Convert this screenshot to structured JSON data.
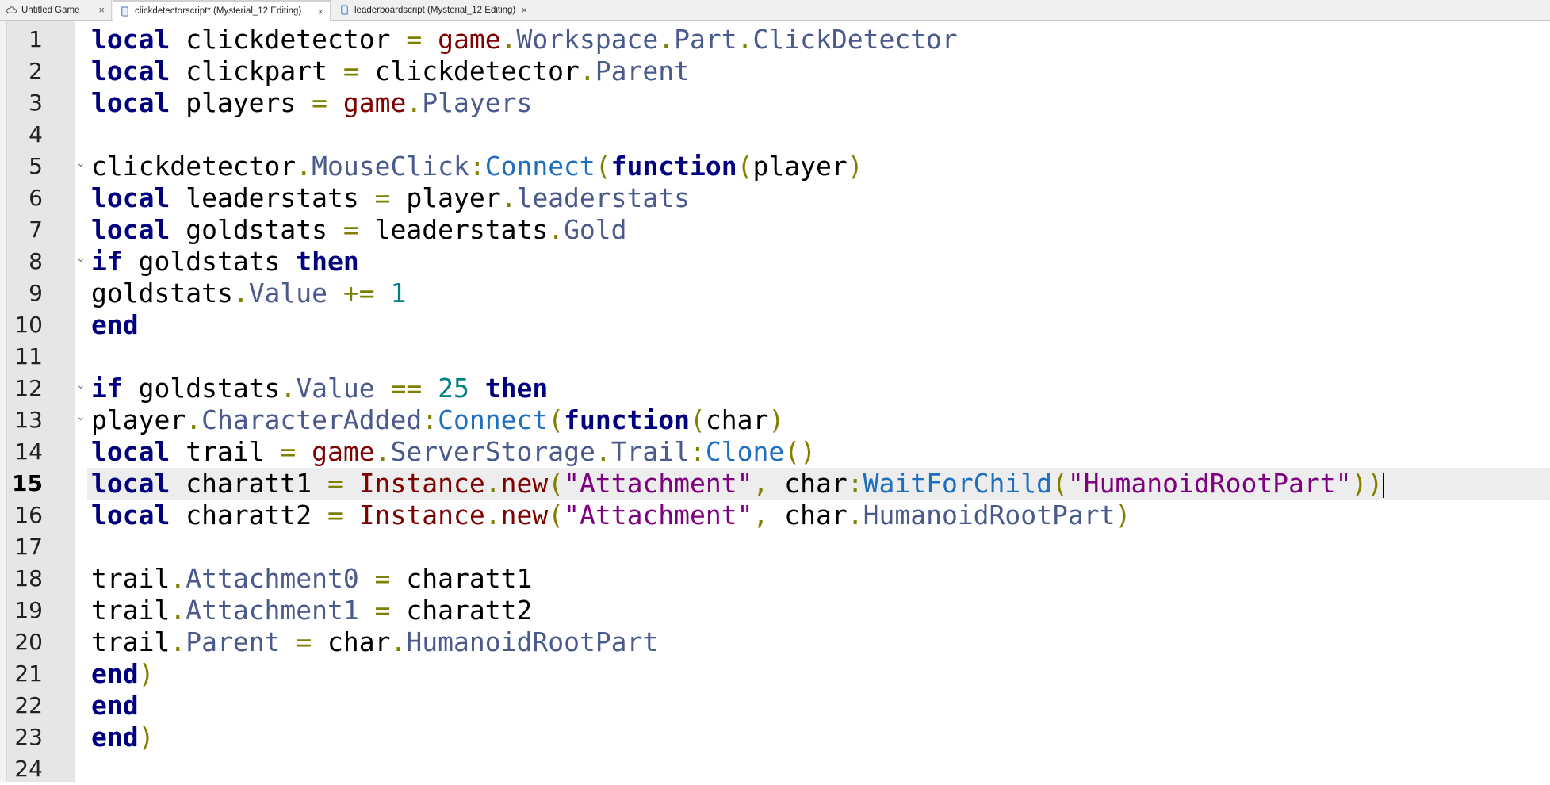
{
  "tabs": [
    {
      "label": "Untitled Game",
      "icon": "cloud-icon",
      "active": false
    },
    {
      "label": "clickdetectorscript* (Mysterial_12 Editing)",
      "icon": "script-icon",
      "active": true
    },
    {
      "label": "leaderboardscript (Mysterial_12 Editing)",
      "icon": "script-icon",
      "active": false
    }
  ],
  "close_glyph": "×",
  "editor": {
    "current_line": 15,
    "fold_lines": [
      5,
      8,
      12,
      13
    ],
    "lines": [
      [
        [
          "k",
          "local"
        ],
        [
          "t",
          " clickdetector "
        ],
        [
          "o",
          "="
        ],
        [
          "t",
          " "
        ],
        [
          "g",
          "game"
        ],
        [
          "o",
          "."
        ],
        [
          "p",
          "Workspace"
        ],
        [
          "o",
          "."
        ],
        [
          "p",
          "Part"
        ],
        [
          "o",
          "."
        ],
        [
          "p",
          "ClickDetector"
        ]
      ],
      [
        [
          "k",
          "local"
        ],
        [
          "t",
          " clickpart "
        ],
        [
          "o",
          "="
        ],
        [
          "t",
          " clickdetector"
        ],
        [
          "o",
          "."
        ],
        [
          "p",
          "Parent"
        ]
      ],
      [
        [
          "k",
          "local"
        ],
        [
          "t",
          " players "
        ],
        [
          "o",
          "="
        ],
        [
          "t",
          " "
        ],
        [
          "g",
          "game"
        ],
        [
          "o",
          "."
        ],
        [
          "p",
          "Players"
        ]
      ],
      [],
      [
        [
          "t",
          "clickdetector"
        ],
        [
          "o",
          "."
        ],
        [
          "p",
          "MouseClick"
        ],
        [
          "o",
          ":"
        ],
        [
          "m",
          "Connect"
        ],
        [
          "o",
          "("
        ],
        [
          "k",
          "function"
        ],
        [
          "o",
          "("
        ],
        [
          "t",
          "player"
        ],
        [
          "o",
          ")"
        ]
      ],
      [
        [
          "k",
          "local"
        ],
        [
          "t",
          " leaderstats "
        ],
        [
          "o",
          "="
        ],
        [
          "t",
          " player"
        ],
        [
          "o",
          "."
        ],
        [
          "p",
          "leaderstats"
        ]
      ],
      [
        [
          "k",
          "local"
        ],
        [
          "t",
          " goldstats "
        ],
        [
          "o",
          "="
        ],
        [
          "t",
          " leaderstats"
        ],
        [
          "o",
          "."
        ],
        [
          "p",
          "Gold"
        ]
      ],
      [
        [
          "k",
          "if"
        ],
        [
          "t",
          " goldstats "
        ],
        [
          "k",
          "then"
        ]
      ],
      [
        [
          "t",
          "goldstats"
        ],
        [
          "o",
          "."
        ],
        [
          "p",
          "Value"
        ],
        [
          "t",
          " "
        ],
        [
          "o",
          "+="
        ],
        [
          "t",
          " "
        ],
        [
          "n",
          "1"
        ]
      ],
      [
        [
          "k",
          "end"
        ]
      ],
      [],
      [
        [
          "k",
          "if"
        ],
        [
          "t",
          " goldstats"
        ],
        [
          "o",
          "."
        ],
        [
          "p",
          "Value"
        ],
        [
          "t",
          " "
        ],
        [
          "o",
          "=="
        ],
        [
          "t",
          " "
        ],
        [
          "n",
          "25"
        ],
        [
          "t",
          " "
        ],
        [
          "k",
          "then"
        ]
      ],
      [
        [
          "t",
          "player"
        ],
        [
          "o",
          "."
        ],
        [
          "p",
          "CharacterAdded"
        ],
        [
          "o",
          ":"
        ],
        [
          "m",
          "Connect"
        ],
        [
          "o",
          "("
        ],
        [
          "k",
          "function"
        ],
        [
          "o",
          "("
        ],
        [
          "t",
          "char"
        ],
        [
          "o",
          ")"
        ]
      ],
      [
        [
          "k",
          "local"
        ],
        [
          "t",
          " trail "
        ],
        [
          "o",
          "="
        ],
        [
          "t",
          " "
        ],
        [
          "g",
          "game"
        ],
        [
          "o",
          "."
        ],
        [
          "p",
          "ServerStorage"
        ],
        [
          "o",
          "."
        ],
        [
          "p",
          "Trail"
        ],
        [
          "o",
          ":"
        ],
        [
          "m",
          "Clone"
        ],
        [
          "o",
          "()"
        ]
      ],
      [
        [
          "k",
          "local"
        ],
        [
          "t",
          " charatt1 "
        ],
        [
          "o",
          "="
        ],
        [
          "t",
          " "
        ],
        [
          "g",
          "Instance"
        ],
        [
          "o",
          "."
        ],
        [
          "g",
          "new"
        ],
        [
          "o",
          "("
        ],
        [
          "s",
          "\"Attachment\""
        ],
        [
          "o",
          ","
        ],
        [
          "t",
          " char"
        ],
        [
          "o",
          ":"
        ],
        [
          "m",
          "WaitForChild"
        ],
        [
          "o",
          "("
        ],
        [
          "s",
          "\"HumanoidRootPart\""
        ],
        [
          "o",
          "))"
        ]
      ],
      [
        [
          "k",
          "local"
        ],
        [
          "t",
          " charatt2 "
        ],
        [
          "o",
          "="
        ],
        [
          "t",
          " "
        ],
        [
          "g",
          "Instance"
        ],
        [
          "o",
          "."
        ],
        [
          "g",
          "new"
        ],
        [
          "o",
          "("
        ],
        [
          "s",
          "\"Attachment\""
        ],
        [
          "o",
          ","
        ],
        [
          "t",
          " char"
        ],
        [
          "o",
          "."
        ],
        [
          "p",
          "HumanoidRootPart"
        ],
        [
          "o",
          ")"
        ]
      ],
      [],
      [
        [
          "t",
          "trail"
        ],
        [
          "o",
          "."
        ],
        [
          "p",
          "Attachment0"
        ],
        [
          "t",
          " "
        ],
        [
          "o",
          "="
        ],
        [
          "t",
          " charatt1"
        ]
      ],
      [
        [
          "t",
          "trail"
        ],
        [
          "o",
          "."
        ],
        [
          "p",
          "Attachment1"
        ],
        [
          "t",
          " "
        ],
        [
          "o",
          "="
        ],
        [
          "t",
          " charatt2"
        ]
      ],
      [
        [
          "t",
          "trail"
        ],
        [
          "o",
          "."
        ],
        [
          "p",
          "Parent"
        ],
        [
          "t",
          " "
        ],
        [
          "o",
          "="
        ],
        [
          "t",
          " char"
        ],
        [
          "o",
          "."
        ],
        [
          "p",
          "HumanoidRootPart"
        ]
      ],
      [
        [
          "k",
          "end"
        ],
        [
          "o",
          ")"
        ]
      ],
      [
        [
          "k",
          "end"
        ]
      ],
      [
        [
          "k",
          "end"
        ],
        [
          "o",
          ")"
        ]
      ],
      []
    ]
  }
}
